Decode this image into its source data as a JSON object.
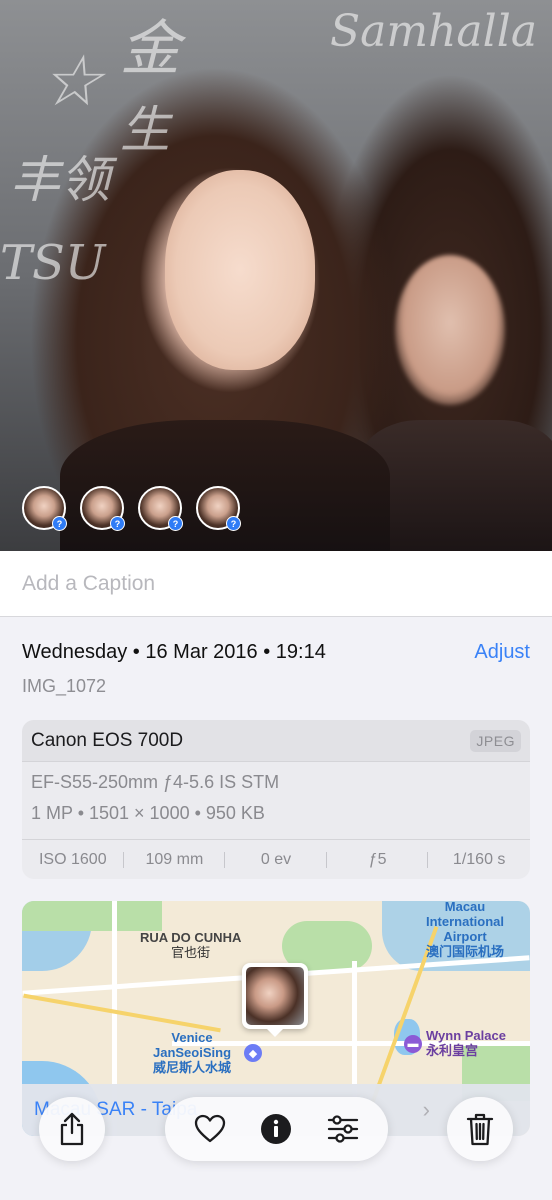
{
  "photo": {
    "scribbles": [
      "Samhalla",
      "金",
      "生",
      "丰领",
      "TSU",
      "☆"
    ],
    "people_count_badge": "?"
  },
  "caption": {
    "placeholder": "Add a Caption"
  },
  "info": {
    "date": "Wednesday • 16 Mar 2016 • 19:14",
    "adjust_label": "Adjust",
    "filename": "IMG_1072"
  },
  "camera": {
    "model": "Canon EOS 700D",
    "format": "JPEG",
    "lens": "EF-S55-250mm ƒ4-5.6 IS STM",
    "details": "1 MP • 1501 × 1000 • 950 KB",
    "exif": [
      "ISO 1600",
      "109 mm",
      "0 ev",
      "ƒ5",
      "1/160 s"
    ]
  },
  "map": {
    "labels": {
      "rua": "RUA DO CUNHA",
      "rua_cn": "官也街",
      "airport": "Macau International Airport",
      "airport_cn": "澳门国际机场",
      "venice": "Venice JanSeoiSing",
      "venice_cn": "威尼斯人水城",
      "wynn": "Wynn Palace",
      "wynn_cn": "永利皇宫"
    },
    "footer_location": "Macau SAR - Taipa"
  },
  "toolbar": {
    "share": "share-icon",
    "favorite": "heart-icon",
    "info": "info-icon",
    "adjust": "sliders-icon",
    "delete": "trash-icon"
  }
}
